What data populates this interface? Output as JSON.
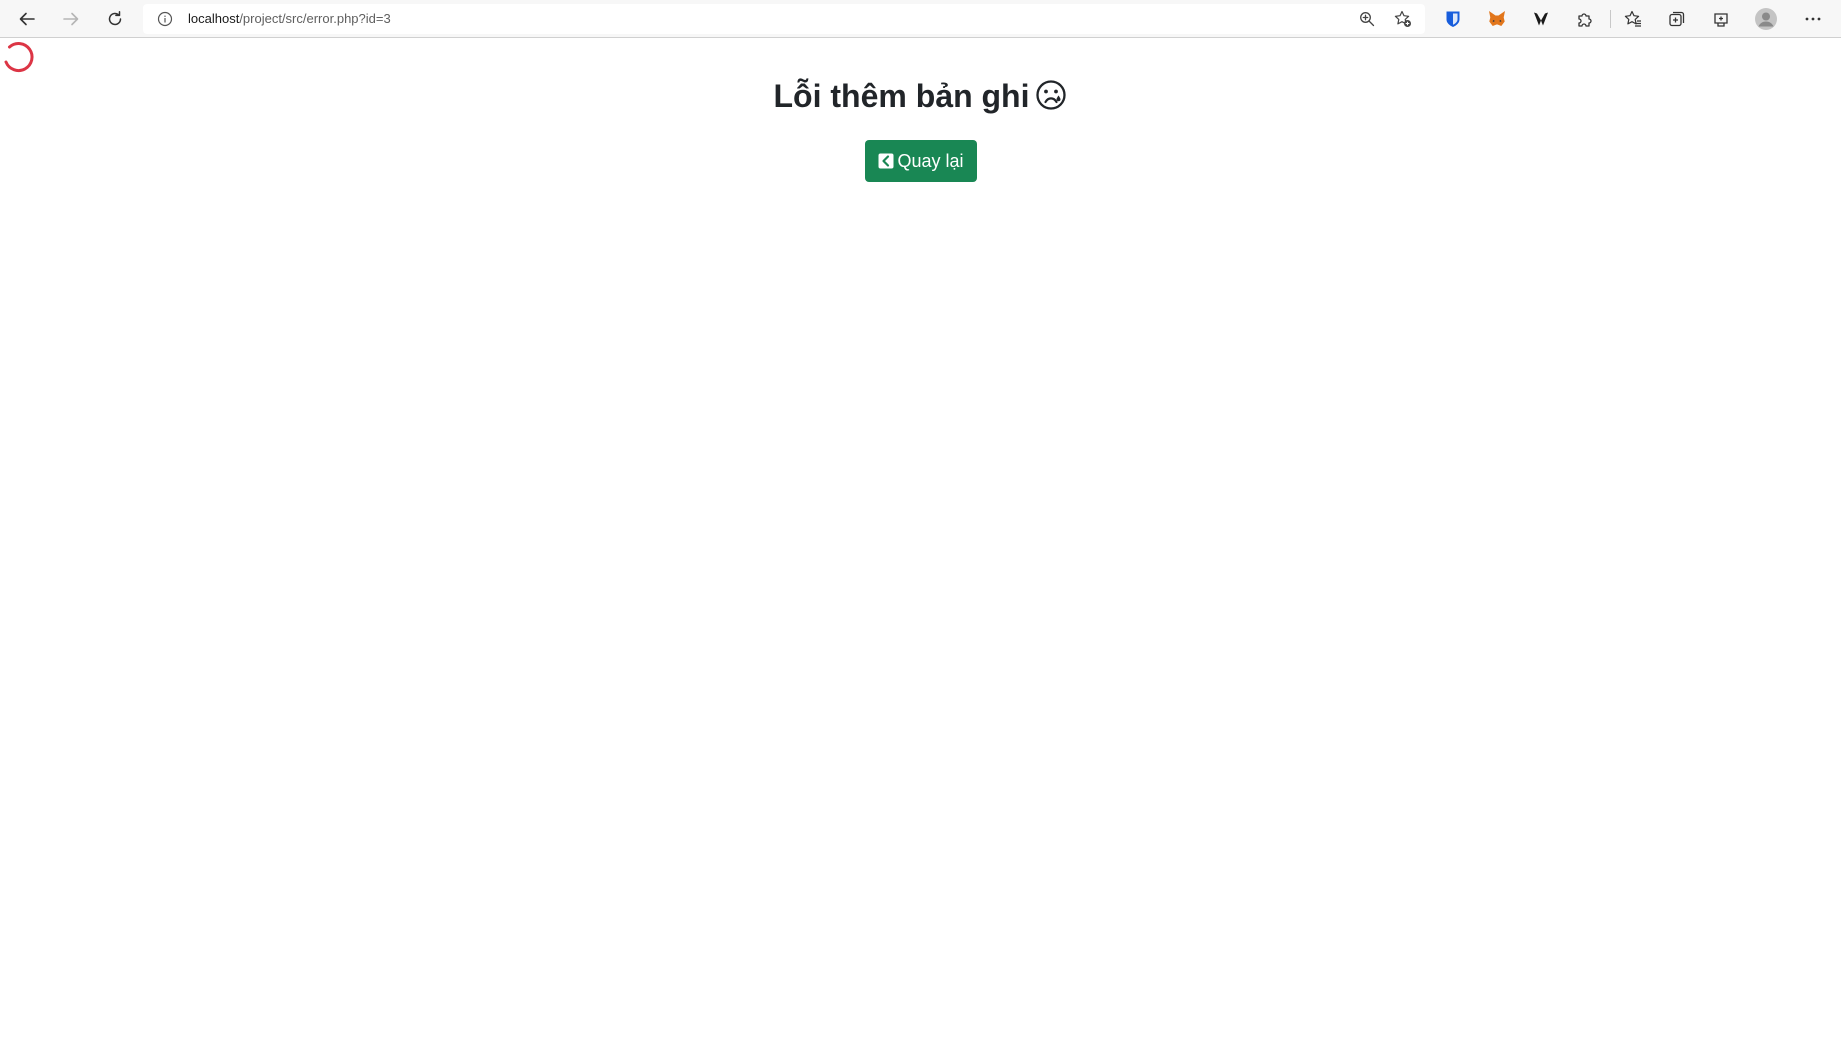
{
  "browser": {
    "url_host": "localhost",
    "url_path": "/project/src/error.php?id=3",
    "icons": {
      "back": "back-arrow-icon",
      "forward": "forward-arrow-icon",
      "refresh": "refresh-icon",
      "site_info": "info-icon",
      "zoom": "zoom-icon",
      "favorite_add": "star-add-icon",
      "extensions": [
        "bitwarden-icon",
        "metamask-icon",
        "wallet-extension-icon",
        "puzzle-extensions-icon"
      ],
      "favorites": "favorites-icon",
      "collections": "collections-icon",
      "browser_essentials": "browser-essentials-icon",
      "profile": "profile-avatar-icon",
      "menu": "more-menu-icon"
    }
  },
  "page": {
    "loading_indicator": "loading-spinner-icon",
    "heading": "Lỗi thêm bản ghi",
    "heading_emoji_icon": "sad-face-icon",
    "back_button_label": "Quay lại",
    "back_button_icon": "chevron-left-square-icon",
    "colors": {
      "button": "#198754",
      "spinner": "#dc3545",
      "heading": "#212529"
    }
  }
}
